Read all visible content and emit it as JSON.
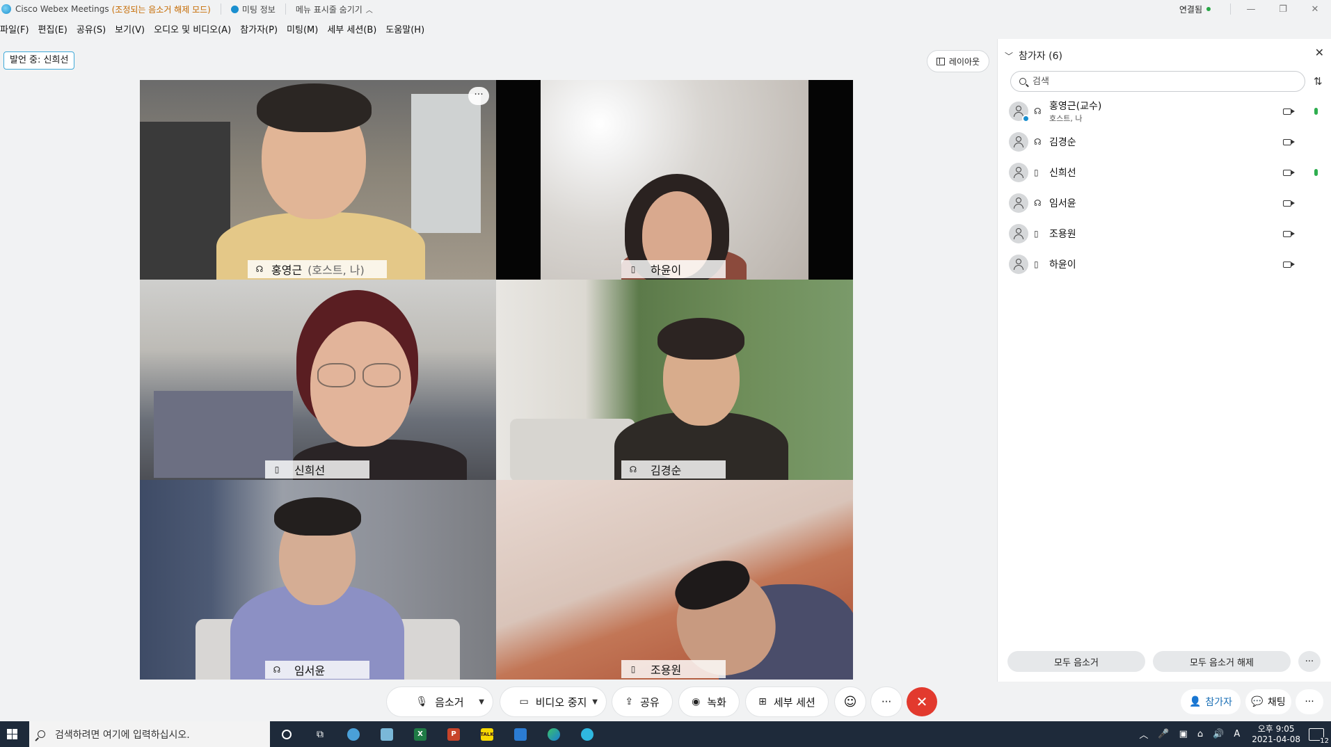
{
  "titlebar": {
    "app_title": "Cisco Webex Meetings",
    "mode_label": "(조정되는 음소거 해제 모드)",
    "meeting_info": "미팅 정보",
    "hide_menu": "메뉴 표시줄 숨기기",
    "status": "연결됨",
    "colors": {
      "mode": "#c56a00",
      "connected": "#27a745"
    }
  },
  "menubar": {
    "items": [
      "파일(F)",
      "편집(E)",
      "공유(S)",
      "보기(V)",
      "오디오 및 비디오(A)",
      "참가자(P)",
      "미팅(M)",
      "세부 세션(B)",
      "도움말(H)"
    ]
  },
  "stage": {
    "speaking_label": "발언 중: 신희선",
    "layout_button": "레이아웃",
    "more_glyph": "···",
    "tiles": [
      {
        "name": "홍영근",
        "sub": "(호스트, 나)",
        "icon": "headset-icon",
        "active": true
      },
      {
        "name": "하윤이",
        "icon": "phone-icon"
      },
      {
        "name": "신희선",
        "icon": "phone-icon",
        "active": true
      },
      {
        "name": "김경순",
        "icon": "headset-icon"
      },
      {
        "name": "임서윤",
        "icon": "headset-icon"
      },
      {
        "name": "조용원",
        "icon": "phone-icon"
      }
    ]
  },
  "panel": {
    "title": "참가자 (6)",
    "search_placeholder": "검색",
    "participants": [
      {
        "name": "홍영근(교수)",
        "sub": "호스트, 나",
        "audio": "headset-icon",
        "speaking": true
      },
      {
        "name": "김경순",
        "audio": "headset-icon",
        "speaking": false
      },
      {
        "name": "신희선",
        "audio": "phone-icon",
        "speaking": true
      },
      {
        "name": "임서윤",
        "audio": "headset-icon",
        "speaking": false
      },
      {
        "name": "조용원",
        "audio": "phone-icon",
        "speaking": false
      },
      {
        "name": "하윤이",
        "audio": "phone-icon",
        "speaking": false
      }
    ],
    "mute_all": "모두 음소거",
    "unmute_all": "모두 음소거 해제"
  },
  "controls": {
    "mute": "음소거",
    "stop_video": "비디오 중지",
    "share": "공유",
    "record": "녹화",
    "breakout": "세부 세션",
    "participants": "참가자",
    "chat": "채팅",
    "end_color": "#e23a2e"
  },
  "taskbar": {
    "search_placeholder": "검색하려면 여기에 입력하십시오.",
    "apps": [
      "cortana-icon",
      "task-view-icon",
      "webex-icon",
      "notes-icon",
      "excel-icon",
      "powerpoint-icon",
      "kakaotalk-icon",
      "outlook-icon",
      "edge-icon",
      "webex-teams-icon"
    ],
    "time_period": "오후 9:05",
    "date": "2021-04-08",
    "ime": "A",
    "notifications": "12"
  }
}
